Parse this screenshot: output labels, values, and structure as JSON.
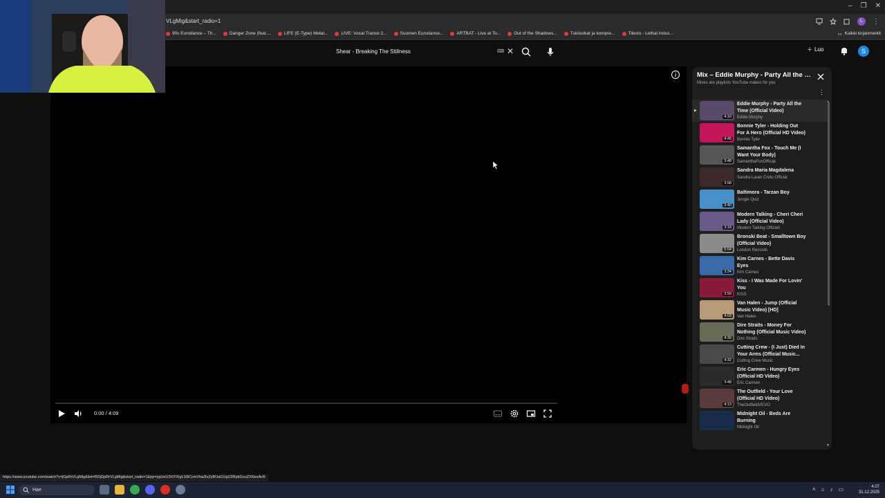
{
  "browser": {
    "url_fragment": "VLgMig&start_radio=1",
    "window_controls": [
      "–",
      "❐",
      "✕"
    ],
    "profile_initial": "L"
  },
  "bookmarks": {
    "items": [
      {
        "label": "90s Eurodance – Th..."
      },
      {
        "label": "Danger Zone (feat...."
      },
      {
        "label": "LIFE (E-Type) Metal..."
      },
      {
        "label": "LIVE: Vocal Trance 2..."
      },
      {
        "label": "Suomen Eurodance..."
      },
      {
        "label": "ARTBAT - Live at To..."
      },
      {
        "label": "Out of the Shadows..."
      },
      {
        "label": "Tukisuikat ja kompre..."
      },
      {
        "label": "Tilesto - Lethal Indus..."
      }
    ],
    "all_bookmarks": "Kaikki kirjanmerkit"
  },
  "masthead": {
    "search_value": "Shear - Breaking The Stillness",
    "create_label": "Luo",
    "account_initial": "S"
  },
  "player": {
    "time": "0:00 / 4:09",
    "progress": 0
  },
  "playlist": {
    "title": "Mix – Eddie Murphy - Party All the Time (Official Video)",
    "subtitle": "Mixes are playlists YouTube makes for you",
    "items": [
      {
        "title": "Eddie Murphy - Party All the Time (Official Video)",
        "channel": "Eddie Murphy",
        "duration": "4:10",
        "color": "#5a4a6a",
        "current": true
      },
      {
        "title": "Bonnie Tyler - Holding Out For A Hero (Official HD Video)",
        "channel": "Bonnie Tyler",
        "duration": "4:45",
        "color": "#c2185b",
        "current": false
      },
      {
        "title": "Samantha Fox - Touch Me (I Want Your Body)",
        "channel": "SamanthaFoxOfficial",
        "duration": "3:48",
        "color": "#555555",
        "current": false
      },
      {
        "title": "Sandra Maria Magdalena",
        "channel": "Sandra Lauer Cretu Official",
        "duration": "3:58",
        "color": "#3a2a2a",
        "current": false
      },
      {
        "title": "Baltimora - Tarzan Boy",
        "channel": "Jungle Quiz",
        "duration": "3:40",
        "color": "#4a90c8",
        "current": false
      },
      {
        "title": "Modern Talking - Cheri Cheri Lady (Official Video)",
        "channel": "Modern Talking Offiziell",
        "duration": "3:18",
        "color": "#6a5a8a",
        "current": false
      },
      {
        "title": "Bronski Beat - Smalltown Boy (Official Video)",
        "channel": "London Records",
        "duration": "5:04",
        "color": "#8a8a8a",
        "current": false
      },
      {
        "title": "Kim Carnes - Bette Davis Eyes",
        "channel": "Kim Carnes",
        "duration": "3:34",
        "color": "#3a6aa8",
        "current": false
      },
      {
        "title": "Kiss - I Was Made For Lovin' You",
        "channel": "KISS",
        "duration": "3:59",
        "color": "#8a1a3a",
        "current": false
      },
      {
        "title": "Van Halen - Jump (Official Music Video) [HD]",
        "channel": "Van Halen",
        "duration": "4:03",
        "color": "#b89a78",
        "current": false
      },
      {
        "title": "Dire Straits - Money For Nothing (Official Music Video)",
        "channel": "Dire Straits",
        "duration": "4:39",
        "color": "#6a6a5a",
        "current": false
      },
      {
        "title": "Cutting Crew - (I Just) Died In Your Arms (Official Music...",
        "channel": "Cutting Crew Music",
        "duration": "4:32",
        "color": "#4a4a4a",
        "current": false
      },
      {
        "title": "Eric Carmen - Hungry Eyes (Official HD Video)",
        "channel": "Eric Carmen",
        "duration": "3:48",
        "color": "#2a2a2a",
        "current": false
      },
      {
        "title": "The Outfield - Your Love (Official HD Video)",
        "channel": "TheOutfieldVEVO",
        "duration": "4:13",
        "color": "#5a3a3a",
        "current": false
      },
      {
        "title": "Midnight Oil - Beds Are Burning",
        "channel": "Midnight Oil",
        "duration": "",
        "color": "#1a2a4a",
        "current": false
      }
    ]
  },
  "statusbar": {
    "link": "https://www.youtube.com/watch?v=jGpRrVLgMig&list=RDjGpRrVLgMig&start_radio=1&pp=ygUeU2hlYXIgLSBCcmVha2luZyBUaGUgU3RpbGxuZXNzoAcB"
  },
  "taskbar": {
    "search_placeholder": "Hae",
    "time": "4.07",
    "date": "31.12.2025",
    "icon_colors": [
      "#5a6a80",
      "#e8b440",
      "#34a853",
      "#5865f2",
      "#d93025",
      "#6a7a90"
    ]
  }
}
